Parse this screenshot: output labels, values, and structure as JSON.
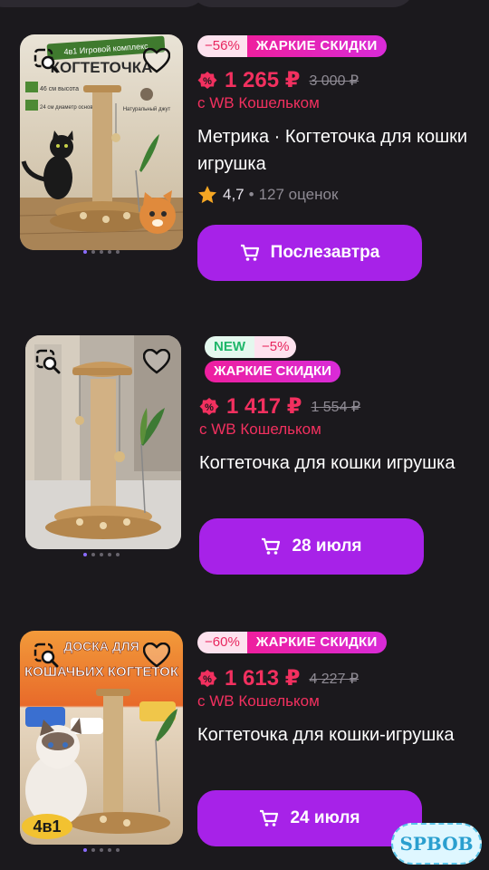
{
  "products": [
    {
      "discount": "−56%",
      "promo": "ЖАРКИЕ СКИДКИ",
      "price": "1 265 ₽",
      "old_price": "3 000 ₽",
      "wallet": "с WB Кошельком",
      "title": "Метрика · Когтеточка для кошки игрушка",
      "rating": "4,7",
      "reviews": "127 оценок",
      "delivery": "Послезавтра",
      "image_text_top": "4в1 Игровой комплекс",
      "image_text_main": "КОГТЕТОЧКА",
      "image_feature_1": "46 см высота",
      "image_feature_2": "24 см диаметр основания",
      "image_feature_3": "Натуральный джут"
    },
    {
      "new_label": "NEW",
      "discount": "−5%",
      "promo": "ЖАРКИЕ СКИДКИ",
      "price": "1 417 ₽",
      "old_price": "1 554 ₽",
      "wallet": "с WB Кошельком",
      "title": "Когтеточка для кошки игрушка",
      "delivery": "28 июля"
    },
    {
      "discount": "−60%",
      "promo": "ЖАРКИЕ СКИДКИ",
      "price": "1 613 ₽",
      "old_price": "4 227 ₽",
      "wallet": "с WB Кошельком",
      "title": "Когтеточка для кошки-игрушка",
      "delivery": "24 июля",
      "image_text_top": "ДОСКА ДЛЯ",
      "image_text_main": "КОШАЧЬИХ КОГТЕТОК",
      "image_text_bottom": "4в1"
    }
  ],
  "watermark": "SPBOB",
  "colors": {
    "background": "#1b191d",
    "price": "#f2305f",
    "button": "#a722e8",
    "promo": "#ee1f9e"
  }
}
